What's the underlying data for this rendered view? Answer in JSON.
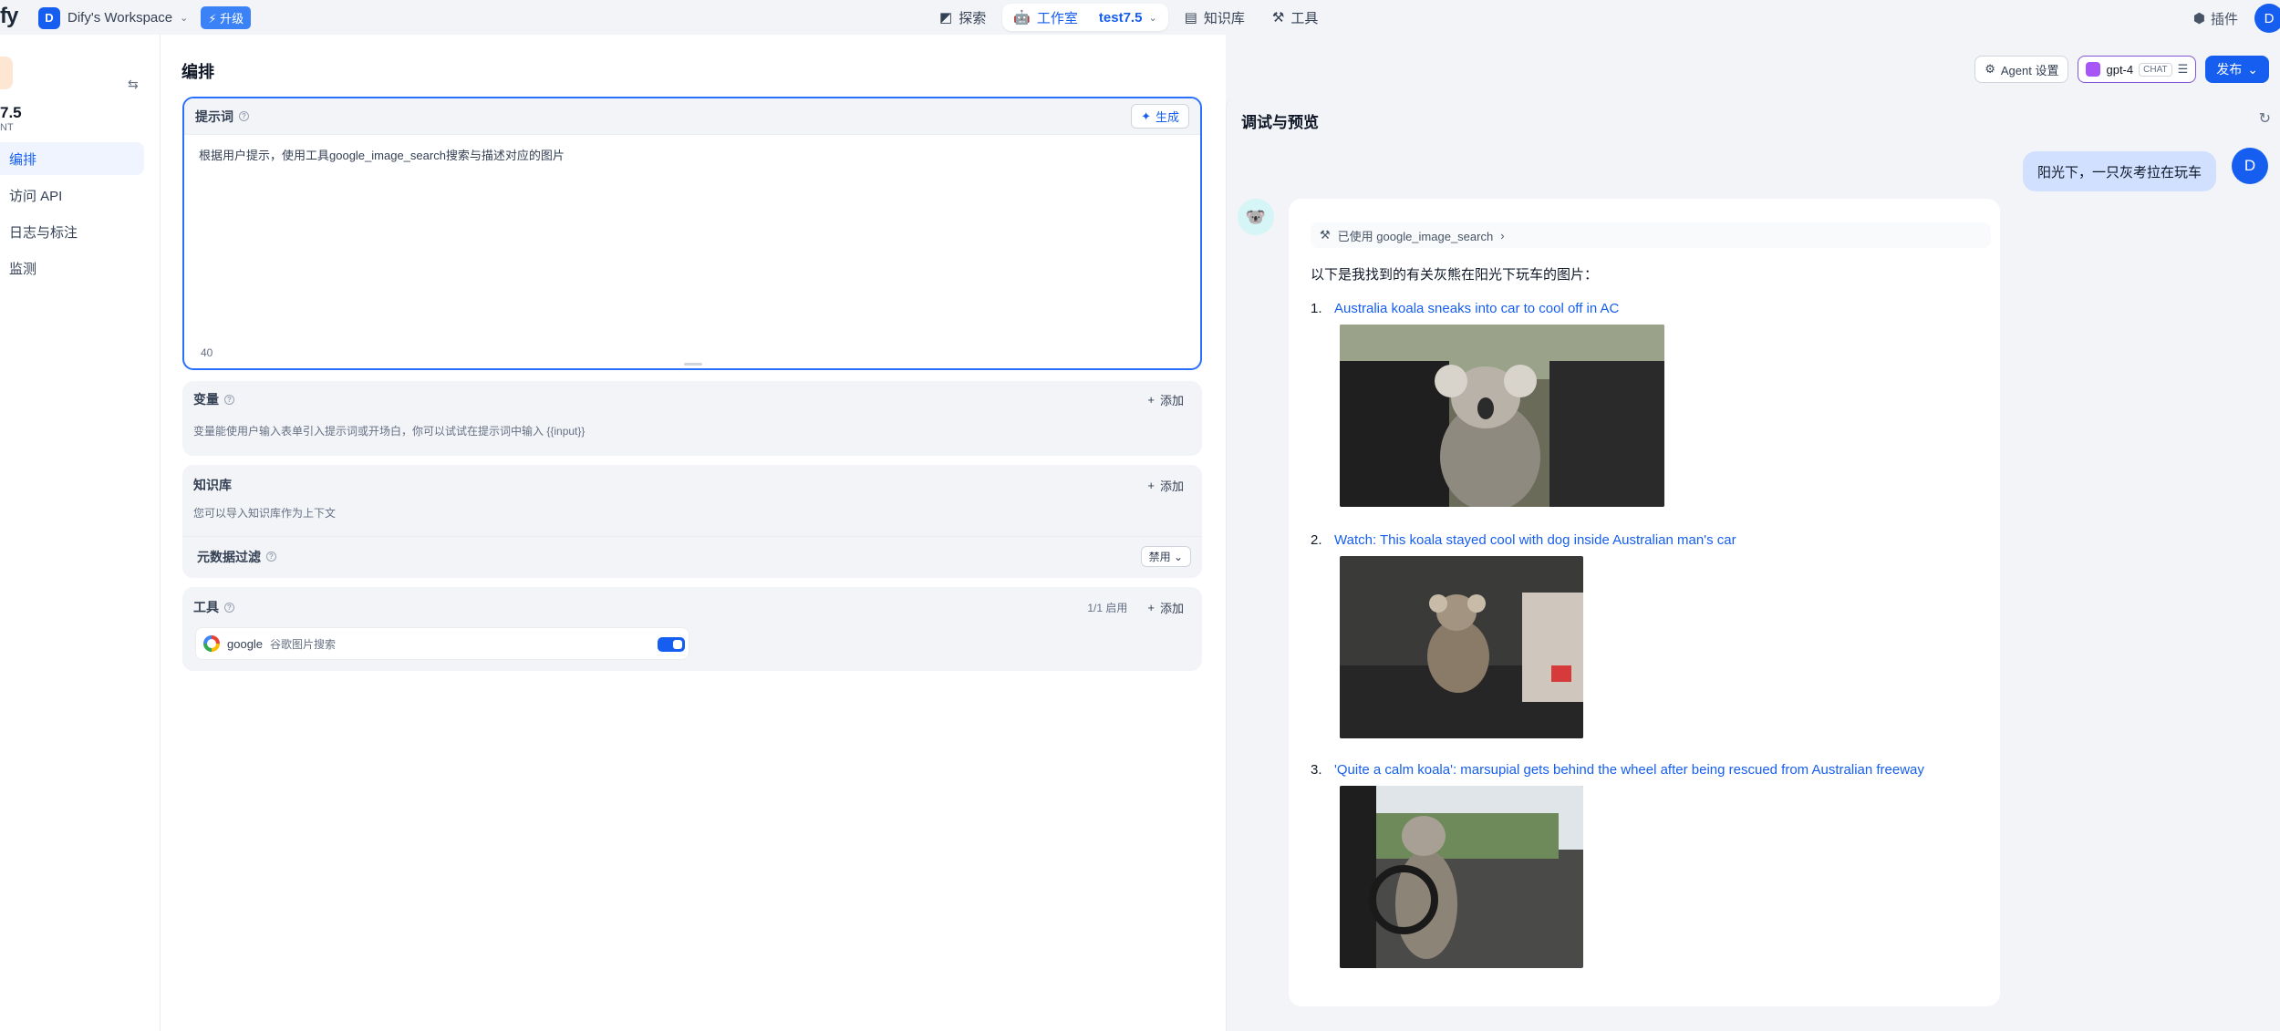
{
  "topbar": {
    "logo": "fy",
    "workspace_initial": "D",
    "workspace_name": "Dify's Workspace",
    "upgrade_label": "升级",
    "nav": {
      "explore": "探索",
      "studio": "工作室",
      "project": "test7.5",
      "knowledge": "知识库",
      "tools": "工具"
    },
    "plugins": "插件",
    "user_initial": "D"
  },
  "sidebar": {
    "app_name": "7.5",
    "app_type": "NT",
    "items": [
      {
        "label": "编排",
        "active": true
      },
      {
        "label": "访问 API"
      },
      {
        "label": "日志与标注"
      },
      {
        "label": "监测"
      }
    ]
  },
  "editor": {
    "title": "编排",
    "prompt": {
      "label": "提示词",
      "generate": "生成",
      "text": "根据用户提示，使用工具google_image_search搜索与描述对应的图片",
      "count": "40"
    },
    "variables": {
      "label": "变量",
      "add": "添加",
      "desc": "变量能使用户输入表单引入提示词或开场白，你可以试试在提示词中输入 {{input}}"
    },
    "knowledge": {
      "label": "知识库",
      "add": "添加",
      "desc": "您可以导入知识库作为上下文",
      "metadata_filter": "元数据过滤",
      "metadata_value": "禁用"
    },
    "tools": {
      "label": "工具",
      "count": "1/1 启用",
      "add": "添加",
      "item_name": "google",
      "item_desc": "谷歌图片搜索"
    }
  },
  "header_buttons": {
    "agent_settings": "Agent 设置",
    "model": "gpt-4",
    "model_tag": "CHAT",
    "publish": "发布"
  },
  "debug": {
    "title": "调试与预览",
    "user_message": "阳光下，一只灰考拉在玩车",
    "user_initial": "D",
    "used_tool": "已使用 google_image_search",
    "intro": "以下是我找到的有关灰熊在阳光下玩车的图片：",
    "results": [
      {
        "num": "1.",
        "title": "Australia koala sneaks into car to cool off in AC"
      },
      {
        "num": "2.",
        "title": "Watch: This koala stayed cool with dog inside Australian man's car"
      },
      {
        "num": "3.",
        "title": "'Quite a calm koala': marsupial gets behind the wheel after being rescued from Australian freeway"
      }
    ]
  },
  "colors": {
    "accent": "#155eef",
    "background": "#f2f4f7",
    "user_bubble": "#d1e0ff"
  }
}
